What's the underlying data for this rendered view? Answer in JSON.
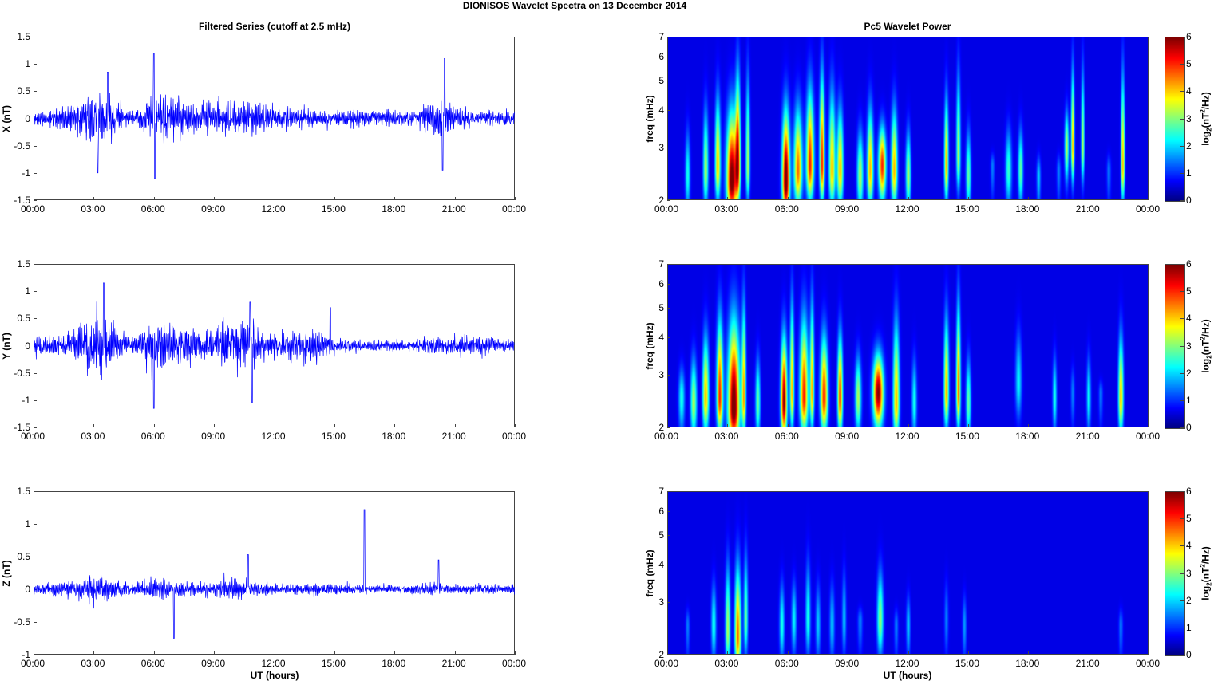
{
  "title": "DIONISOS Wavelet Spectra on 13 December  2014",
  "left_title": "Filtered Series (cutoff at 2.5 mHz)",
  "right_title": "Pc5 Wavelet Power",
  "xlabel": "UT (hours)",
  "xticks": [
    "00:00",
    "03:00",
    "06:00",
    "09:00",
    "12:00",
    "15:00",
    "18:00",
    "21:00",
    "00:00"
  ],
  "colorbar_label": {
    "a": "log",
    "b": "2",
    "c": "(nT",
    "d": "2",
    "e": "/Hz)"
  },
  "colors": {
    "series": "#0000ff",
    "axis": "#444444"
  },
  "chart_data": [
    {
      "type": "line",
      "name": "X",
      "ylabel": "X (nT)",
      "ylim": [
        -1.5,
        1.5
      ],
      "yticks": [
        "1.5",
        "1",
        "0.5",
        "0",
        "-0.5",
        "-1",
        "-1.5"
      ],
      "ytick_values": [
        1.5,
        1,
        0.5,
        0,
        -0.5,
        -1,
        -1.5
      ],
      "hourly_amplitude": [
        0.15,
        0.25,
        0.35,
        0.7,
        0.4,
        0.2,
        0.6,
        0.5,
        0.5,
        0.4,
        0.45,
        0.4,
        0.3,
        0.25,
        0.25,
        0.2,
        0.2,
        0.2,
        0.2,
        0.2,
        0.5,
        0.3,
        0.2,
        0.2
      ],
      "spikes": [
        [
          6.0,
          1.2
        ],
        [
          6.05,
          -1.1
        ],
        [
          3.2,
          -1.0
        ],
        [
          20.5,
          1.1
        ],
        [
          20.4,
          -0.95
        ],
        [
          3.7,
          0.85
        ]
      ]
    },
    {
      "type": "line",
      "name": "Y",
      "ylabel": "Y (nT)",
      "ylim": [
        -1.5,
        1.5
      ],
      "yticks": [
        "1.5",
        "1",
        "0.5",
        "0",
        "-0.5",
        "-1",
        "-1.5"
      ],
      "ytick_values": [
        1.5,
        1,
        0.5,
        0,
        -0.5,
        -1,
        -1.5
      ],
      "hourly_amplitude": [
        0.2,
        0.25,
        0.4,
        0.9,
        0.5,
        0.2,
        0.7,
        0.6,
        0.5,
        0.4,
        0.7,
        0.5,
        0.35,
        0.35,
        0.45,
        0.2,
        0.15,
        0.15,
        0.15,
        0.15,
        0.2,
        0.25,
        0.25,
        0.2
      ],
      "spikes": [
        [
          3.5,
          1.15
        ],
        [
          6.0,
          -1.15
        ],
        [
          10.9,
          -1.05
        ],
        [
          10.8,
          0.8
        ],
        [
          14.8,
          0.7
        ]
      ]
    },
    {
      "type": "line",
      "name": "Z",
      "ylabel": "Z (nT)",
      "ylim": [
        -1,
        1.5
      ],
      "yticks": [
        "1.5",
        "1",
        "0.5",
        "0",
        "-0.5",
        "-1"
      ],
      "ytick_values": [
        1.5,
        1,
        0.5,
        0,
        -0.5,
        -1
      ],
      "hourly_amplitude": [
        0.1,
        0.15,
        0.2,
        0.3,
        0.2,
        0.15,
        0.25,
        0.2,
        0.15,
        0.15,
        0.25,
        0.15,
        0.12,
        0.12,
        0.12,
        0.12,
        0.1,
        0.1,
        0.1,
        0.1,
        0.15,
        0.1,
        0.1,
        0.1
      ],
      "spikes": [
        [
          16.5,
          1.22
        ],
        [
          7.0,
          -0.75
        ],
        [
          20.2,
          0.45
        ],
        [
          10.7,
          0.53
        ]
      ]
    },
    {
      "type": "heatmap",
      "name": "X power",
      "ylabel": "freq (mHz)",
      "ylim": [
        2,
        7
      ],
      "yticks": [
        "2",
        "3",
        "4",
        "5",
        "6",
        "7"
      ],
      "ytick_values": [
        2,
        3,
        4,
        5,
        6,
        7
      ],
      "clim": [
        0,
        6
      ],
      "cticks": [
        "0",
        "1",
        "2",
        "3",
        "4",
        "5",
        "6"
      ],
      "blobs": [
        [
          1.0,
          2.4,
          2,
          0.12,
          4
        ],
        [
          1.9,
          2.5,
          3,
          0.12,
          5
        ],
        [
          2.5,
          2.6,
          4,
          0.13,
          5.5
        ],
        [
          3.2,
          2.3,
          6.3,
          0.25,
          5
        ],
        [
          3.5,
          2.6,
          5,
          0.12,
          7
        ],
        [
          4.0,
          2.6,
          3,
          0.1,
          7
        ],
        [
          5.9,
          2.3,
          6.5,
          0.18,
          5
        ],
        [
          6.5,
          2.5,
          4.5,
          0.2,
          5
        ],
        [
          7.1,
          2.6,
          5,
          0.18,
          6
        ],
        [
          7.7,
          2.6,
          5,
          0.12,
          7
        ],
        [
          8.2,
          2.5,
          4,
          0.15,
          6
        ],
        [
          8.6,
          2.5,
          4,
          0.15,
          5
        ],
        [
          9.6,
          2.4,
          3,
          0.15,
          4
        ],
        [
          10.1,
          2.5,
          4,
          0.15,
          5
        ],
        [
          10.7,
          2.6,
          5,
          0.18,
          4
        ],
        [
          11.3,
          2.5,
          4,
          0.15,
          5
        ],
        [
          12.0,
          2.4,
          3,
          0.12,
          4
        ],
        [
          13.9,
          2.6,
          4,
          0.1,
          5.5
        ],
        [
          14.5,
          2.8,
          3,
          0.1,
          7
        ],
        [
          15.0,
          2.4,
          2.5,
          0.12,
          4
        ],
        [
          16.2,
          2.6,
          1,
          0.1,
          3
        ],
        [
          17.0,
          2.5,
          2.2,
          0.15,
          4
        ],
        [
          17.6,
          2.5,
          2.5,
          0.12,
          4
        ],
        [
          18.5,
          2.4,
          1.5,
          0.1,
          3
        ],
        [
          19.5,
          2.5,
          1,
          0.1,
          3
        ],
        [
          19.9,
          3.0,
          3,
          0.1,
          4.5
        ],
        [
          20.2,
          3.0,
          4,
          0.08,
          7
        ],
        [
          20.7,
          3.0,
          3,
          0.08,
          7
        ],
        [
          22.0,
          2.5,
          1,
          0.1,
          3
        ],
        [
          22.7,
          2.6,
          4,
          0.09,
          7
        ]
      ]
    },
    {
      "type": "heatmap",
      "name": "Y power",
      "ylabel": "freq (mHz)",
      "ylim": [
        2,
        7
      ],
      "yticks": [
        "2",
        "3",
        "4",
        "5",
        "6",
        "7"
      ],
      "ytick_values": [
        2,
        3,
        4,
        5,
        6,
        7
      ],
      "clim": [
        0,
        6
      ],
      "cticks": [
        "0",
        "1",
        "2",
        "3",
        "4",
        "5",
        "6"
      ],
      "blobs": [
        [
          0.7,
          2.5,
          2,
          0.15,
          3.5
        ],
        [
          1.3,
          2.4,
          3,
          0.15,
          4
        ],
        [
          1.9,
          2.5,
          4,
          0.15,
          5
        ],
        [
          2.6,
          2.5,
          5,
          0.15,
          6
        ],
        [
          3.3,
          2.3,
          6.5,
          0.28,
          6
        ],
        [
          3.8,
          2.5,
          4,
          0.1,
          7
        ],
        [
          4.5,
          2.4,
          2.5,
          0.12,
          4
        ],
        [
          5.8,
          2.4,
          6,
          0.15,
          5
        ],
        [
          6.2,
          2.6,
          4,
          0.1,
          7
        ],
        [
          6.8,
          2.5,
          5,
          0.2,
          6
        ],
        [
          7.2,
          2.6,
          4,
          0.1,
          7
        ],
        [
          7.8,
          2.5,
          5,
          0.18,
          5
        ],
        [
          8.6,
          2.5,
          5,
          0.12,
          5
        ],
        [
          9.5,
          2.5,
          3,
          0.15,
          4
        ],
        [
          10.5,
          2.6,
          6,
          0.25,
          4
        ],
        [
          11.4,
          2.4,
          4,
          0.15,
          6
        ],
        [
          12.3,
          2.4,
          2,
          0.12,
          4
        ],
        [
          13.9,
          2.6,
          4,
          0.12,
          6
        ],
        [
          14.5,
          2.6,
          4.5,
          0.1,
          7
        ],
        [
          15.0,
          2.4,
          2.5,
          0.12,
          4
        ],
        [
          17.5,
          2.8,
          1.8,
          0.15,
          5
        ],
        [
          19.3,
          2.5,
          2,
          0.1,
          4
        ],
        [
          20.2,
          2.6,
          1,
          0.1,
          3.5
        ],
        [
          21.0,
          2.5,
          2,
          0.1,
          4
        ],
        [
          21.6,
          2.6,
          1,
          0.1,
          3
        ],
        [
          22.6,
          2.5,
          4,
          0.12,
          5
        ]
      ]
    },
    {
      "type": "heatmap",
      "name": "Z power",
      "ylabel": "freq (mHz)",
      "ylim": [
        2,
        7
      ],
      "yticks": [
        "2",
        "3",
        "4",
        "5",
        "6",
        "7"
      ],
      "ytick_values": [
        2,
        3,
        4,
        5,
        6,
        7
      ],
      "clim": [
        0,
        6
      ],
      "cticks": [
        "0",
        "1",
        "2",
        "3",
        "4",
        "5",
        "6"
      ],
      "blobs": [
        [
          1.0,
          2.5,
          1,
          0.1,
          3
        ],
        [
          2.3,
          2.5,
          2,
          0.12,
          4
        ],
        [
          3.0,
          2.4,
          3,
          0.12,
          5
        ],
        [
          3.5,
          2.3,
          4.5,
          0.15,
          5
        ],
        [
          3.9,
          2.6,
          2.5,
          0.1,
          5.5
        ],
        [
          5.7,
          2.5,
          2,
          0.12,
          4
        ],
        [
          6.3,
          2.6,
          1.8,
          0.12,
          4
        ],
        [
          7.0,
          2.6,
          2,
          0.12,
          5
        ],
        [
          7.5,
          2.5,
          1.5,
          0.12,
          4
        ],
        [
          8.2,
          2.5,
          1.5,
          0.12,
          4
        ],
        [
          8.8,
          2.6,
          1.5,
          0.1,
          4.5
        ],
        [
          9.6,
          2.6,
          1,
          0.12,
          3
        ],
        [
          10.6,
          2.6,
          2.8,
          0.15,
          4.5
        ],
        [
          11.4,
          2.5,
          1,
          0.1,
          3
        ],
        [
          12.0,
          2.5,
          1.5,
          0.1,
          3.5
        ],
        [
          13.9,
          2.6,
          1,
          0.1,
          4
        ],
        [
          14.8,
          2.5,
          1.2,
          0.1,
          3.5
        ],
        [
          22.6,
          2.5,
          1,
          0.1,
          3
        ]
      ]
    }
  ]
}
